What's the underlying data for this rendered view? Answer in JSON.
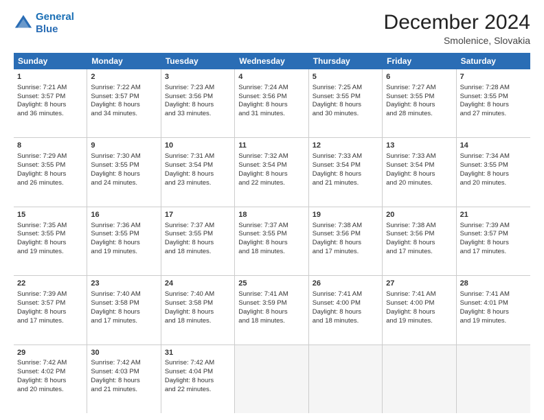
{
  "header": {
    "logo_line1": "General",
    "logo_line2": "Blue",
    "main_title": "December 2024",
    "subtitle": "Smolenice, Slovakia"
  },
  "days_of_week": [
    "Sunday",
    "Monday",
    "Tuesday",
    "Wednesday",
    "Thursday",
    "Friday",
    "Saturday"
  ],
  "weeks": [
    [
      {
        "day": "1",
        "sunrise": "Sunrise: 7:21 AM",
        "sunset": "Sunset: 3:57 PM",
        "daylight": "Daylight: 8 hours and 36 minutes."
      },
      {
        "day": "2",
        "sunrise": "Sunrise: 7:22 AM",
        "sunset": "Sunset: 3:57 PM",
        "daylight": "Daylight: 8 hours and 34 minutes."
      },
      {
        "day": "3",
        "sunrise": "Sunrise: 7:23 AM",
        "sunset": "Sunset: 3:56 PM",
        "daylight": "Daylight: 8 hours and 33 minutes."
      },
      {
        "day": "4",
        "sunrise": "Sunrise: 7:24 AM",
        "sunset": "Sunset: 3:56 PM",
        "daylight": "Daylight: 8 hours and 31 minutes."
      },
      {
        "day": "5",
        "sunrise": "Sunrise: 7:25 AM",
        "sunset": "Sunset: 3:55 PM",
        "daylight": "Daylight: 8 hours and 30 minutes."
      },
      {
        "day": "6",
        "sunrise": "Sunrise: 7:27 AM",
        "sunset": "Sunset: 3:55 PM",
        "daylight": "Daylight: 8 hours and 28 minutes."
      },
      {
        "day": "7",
        "sunrise": "Sunrise: 7:28 AM",
        "sunset": "Sunset: 3:55 PM",
        "daylight": "Daylight: 8 hours and 27 minutes."
      }
    ],
    [
      {
        "day": "8",
        "sunrise": "Sunrise: 7:29 AM",
        "sunset": "Sunset: 3:55 PM",
        "daylight": "Daylight: 8 hours and 26 minutes."
      },
      {
        "day": "9",
        "sunrise": "Sunrise: 7:30 AM",
        "sunset": "Sunset: 3:55 PM",
        "daylight": "Daylight: 8 hours and 24 minutes."
      },
      {
        "day": "10",
        "sunrise": "Sunrise: 7:31 AM",
        "sunset": "Sunset: 3:54 PM",
        "daylight": "Daylight: 8 hours and 23 minutes."
      },
      {
        "day": "11",
        "sunrise": "Sunrise: 7:32 AM",
        "sunset": "Sunset: 3:54 PM",
        "daylight": "Daylight: 8 hours and 22 minutes."
      },
      {
        "day": "12",
        "sunrise": "Sunrise: 7:33 AM",
        "sunset": "Sunset: 3:54 PM",
        "daylight": "Daylight: 8 hours and 21 minutes."
      },
      {
        "day": "13",
        "sunrise": "Sunrise: 7:33 AM",
        "sunset": "Sunset: 3:54 PM",
        "daylight": "Daylight: 8 hours and 20 minutes."
      },
      {
        "day": "14",
        "sunrise": "Sunrise: 7:34 AM",
        "sunset": "Sunset: 3:55 PM",
        "daylight": "Daylight: 8 hours and 20 minutes."
      }
    ],
    [
      {
        "day": "15",
        "sunrise": "Sunrise: 7:35 AM",
        "sunset": "Sunset: 3:55 PM",
        "daylight": "Daylight: 8 hours and 19 minutes."
      },
      {
        "day": "16",
        "sunrise": "Sunrise: 7:36 AM",
        "sunset": "Sunset: 3:55 PM",
        "daylight": "Daylight: 8 hours and 19 minutes."
      },
      {
        "day": "17",
        "sunrise": "Sunrise: 7:37 AM",
        "sunset": "Sunset: 3:55 PM",
        "daylight": "Daylight: 8 hours and 18 minutes."
      },
      {
        "day": "18",
        "sunrise": "Sunrise: 7:37 AM",
        "sunset": "Sunset: 3:55 PM",
        "daylight": "Daylight: 8 hours and 18 minutes."
      },
      {
        "day": "19",
        "sunrise": "Sunrise: 7:38 AM",
        "sunset": "Sunset: 3:56 PM",
        "daylight": "Daylight: 8 hours and 17 minutes."
      },
      {
        "day": "20",
        "sunrise": "Sunrise: 7:38 AM",
        "sunset": "Sunset: 3:56 PM",
        "daylight": "Daylight: 8 hours and 17 minutes."
      },
      {
        "day": "21",
        "sunrise": "Sunrise: 7:39 AM",
        "sunset": "Sunset: 3:57 PM",
        "daylight": "Daylight: 8 hours and 17 minutes."
      }
    ],
    [
      {
        "day": "22",
        "sunrise": "Sunrise: 7:39 AM",
        "sunset": "Sunset: 3:57 PM",
        "daylight": "Daylight: 8 hours and 17 minutes."
      },
      {
        "day": "23",
        "sunrise": "Sunrise: 7:40 AM",
        "sunset": "Sunset: 3:58 PM",
        "daylight": "Daylight: 8 hours and 17 minutes."
      },
      {
        "day": "24",
        "sunrise": "Sunrise: 7:40 AM",
        "sunset": "Sunset: 3:58 PM",
        "daylight": "Daylight: 8 hours and 18 minutes."
      },
      {
        "day": "25",
        "sunrise": "Sunrise: 7:41 AM",
        "sunset": "Sunset: 3:59 PM",
        "daylight": "Daylight: 8 hours and 18 minutes."
      },
      {
        "day": "26",
        "sunrise": "Sunrise: 7:41 AM",
        "sunset": "Sunset: 4:00 PM",
        "daylight": "Daylight: 8 hours and 18 minutes."
      },
      {
        "day": "27",
        "sunrise": "Sunrise: 7:41 AM",
        "sunset": "Sunset: 4:00 PM",
        "daylight": "Daylight: 8 hours and 19 minutes."
      },
      {
        "day": "28",
        "sunrise": "Sunrise: 7:41 AM",
        "sunset": "Sunset: 4:01 PM",
        "daylight": "Daylight: 8 hours and 19 minutes."
      }
    ],
    [
      {
        "day": "29",
        "sunrise": "Sunrise: 7:42 AM",
        "sunset": "Sunset: 4:02 PM",
        "daylight": "Daylight: 8 hours and 20 minutes."
      },
      {
        "day": "30",
        "sunrise": "Sunrise: 7:42 AM",
        "sunset": "Sunset: 4:03 PM",
        "daylight": "Daylight: 8 hours and 21 minutes."
      },
      {
        "day": "31",
        "sunrise": "Sunrise: 7:42 AM",
        "sunset": "Sunset: 4:04 PM",
        "daylight": "Daylight: 8 hours and 22 minutes."
      },
      {
        "day": "",
        "sunrise": "",
        "sunset": "",
        "daylight": ""
      },
      {
        "day": "",
        "sunrise": "",
        "sunset": "",
        "daylight": ""
      },
      {
        "day": "",
        "sunrise": "",
        "sunset": "",
        "daylight": ""
      },
      {
        "day": "",
        "sunrise": "",
        "sunset": "",
        "daylight": ""
      }
    ]
  ]
}
